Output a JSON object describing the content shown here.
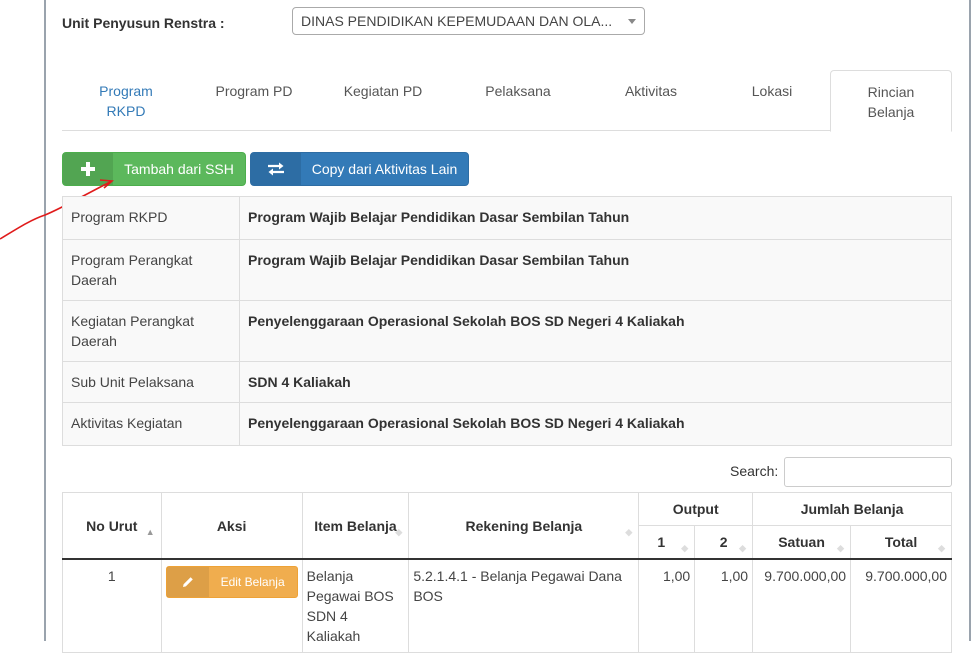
{
  "unit": {
    "label": "Unit Penyusun Renstra :",
    "selected": "DINAS PENDIDIKAN KEPEMUDAAN DAN OLA..."
  },
  "tabs": [
    {
      "line1": "Program",
      "line2": "RKPD"
    },
    {
      "line1": "Program PD",
      "line2": ""
    },
    {
      "line1": "Kegiatan PD",
      "line2": ""
    },
    {
      "line1": "Pelaksana",
      "line2": ""
    },
    {
      "line1": "Aktivitas",
      "line2": ""
    },
    {
      "line1": "Lokasi",
      "line2": ""
    },
    {
      "line1": "Rincian",
      "line2": "Belanja"
    }
  ],
  "buttons": {
    "add_ssh": "Tambah dari SSH",
    "copy": "Copy dari Aktivitas Lain"
  },
  "info": [
    {
      "key": "Program RKPD",
      "value": "Program Wajib Belajar Pendidikan Dasar Sembilan Tahun"
    },
    {
      "key": "Program Perangkat Daerah",
      "value": "Program Wajib Belajar Pendidikan Dasar Sembilan Tahun"
    },
    {
      "key": "Kegiatan Perangkat Daerah",
      "value": "Penyelenggaraan Operasional Sekolah BOS SD Negeri 4 Kaliakah"
    },
    {
      "key": "Sub Unit Pelaksana",
      "value": "SDN 4 Kaliakah"
    },
    {
      "key": "Aktivitas Kegiatan",
      "value": "Penyelenggaraan Operasional Sekolah BOS SD Negeri 4 Kaliakah"
    }
  ],
  "search": {
    "label": "Search:",
    "value": ""
  },
  "table": {
    "headers": {
      "no": "No Urut",
      "aksi": "Aksi",
      "item": "Item Belanja",
      "rekening": "Rekening Belanja",
      "output": "Output",
      "out1": "1",
      "out2": "2",
      "jumlah": "Jumlah Belanja",
      "satuan": "Satuan",
      "total": "Total"
    },
    "rows": [
      {
        "no": "1",
        "edit_label": "Edit Belanja",
        "item": "Belanja Pegawai BOS SDN 4 Kaliakah",
        "rekening": "5.2.1.4.1 - Belanja Pegawai Dana BOS",
        "out1": "1,00",
        "out2": "1,00",
        "satuan": "9.700.000,00",
        "total": "9.700.000,00"
      }
    ]
  },
  "colors": {
    "primary": "#337ab7",
    "success": "#5cb85c",
    "warning": "#f0ad4e",
    "annotation": "#e01b1b"
  }
}
